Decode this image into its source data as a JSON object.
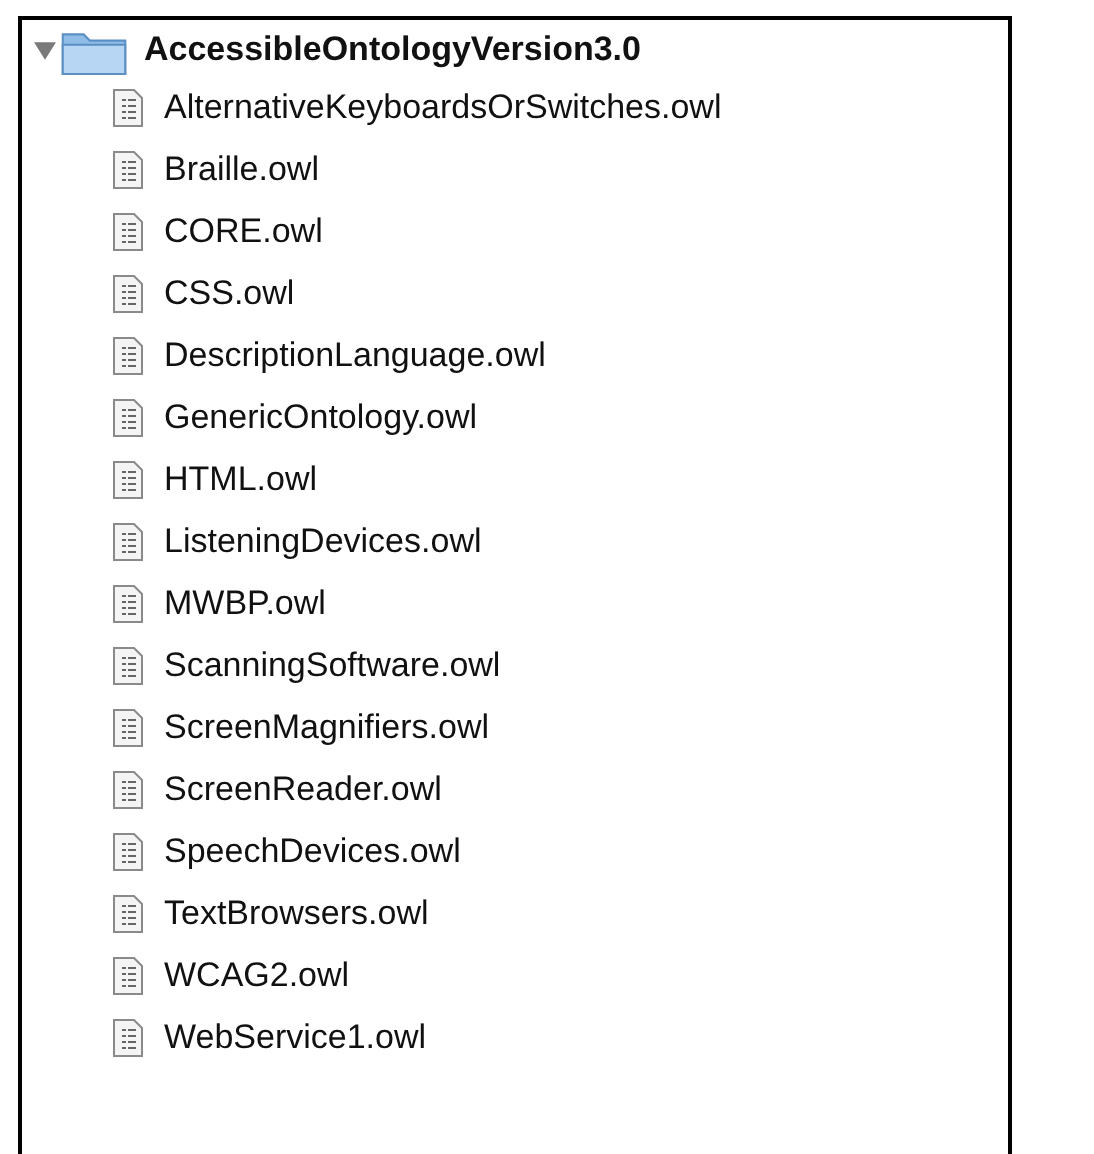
{
  "folder": {
    "name": "AccessibleOntologyVersion3.0",
    "expanded": true,
    "children": [
      {
        "name": "AlternativeKeyboardsOrSwitches.owl"
      },
      {
        "name": "Braille.owl"
      },
      {
        "name": "CORE.owl"
      },
      {
        "name": "CSS.owl"
      },
      {
        "name": "DescriptionLanguage.owl"
      },
      {
        "name": "GenericOntology.owl"
      },
      {
        "name": "HTML.owl"
      },
      {
        "name": "ListeningDevices.owl"
      },
      {
        "name": "MWBP.owl"
      },
      {
        "name": "ScanningSoftware.owl"
      },
      {
        "name": "ScreenMagnifiers.owl"
      },
      {
        "name": "ScreenReader.owl"
      },
      {
        "name": "SpeechDevices.owl"
      },
      {
        "name": "TextBrowsers.owl"
      },
      {
        "name": "WCAG2.owl"
      },
      {
        "name": "WebService1.owl"
      }
    ]
  }
}
